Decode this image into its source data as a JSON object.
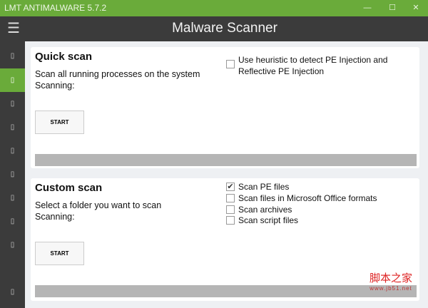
{
  "window": {
    "title": "LMT ANTIMALWARE 5.7.2",
    "minimize": "—",
    "maximize": "☐",
    "close": "✕"
  },
  "header": {
    "menu_icon": "☰",
    "title": "Malware Scanner"
  },
  "sidebar": {
    "items": [
      "▯",
      "▯",
      "▯",
      "▯",
      "▯",
      "▯",
      "▯",
      "▯",
      "▯",
      "▯"
    ],
    "active_index": 1
  },
  "quick_scan": {
    "title": "Quick scan",
    "description": "Scan all running processes on the system",
    "status": "Scanning:",
    "start": "START",
    "progress": 0,
    "options": [
      {
        "label": "Use heuristic to detect PE Injection and",
        "label2": "Reflective PE Injection",
        "checked": false
      }
    ]
  },
  "custom_scan": {
    "title": "Custom scan",
    "description": "Select a folder you want to scan",
    "status": "Scanning:",
    "start": "START",
    "progress": 0,
    "options": [
      {
        "label": "Scan PE files",
        "checked": true
      },
      {
        "label": "Scan files in Microsoft Office formats",
        "checked": false
      },
      {
        "label": "Scan archives",
        "checked": false
      },
      {
        "label": "Scan script files",
        "checked": false
      }
    ]
  },
  "watermark": {
    "text": "脚本之家",
    "url": "www.jb51.net"
  },
  "colors": {
    "accent": "#6aab3a",
    "dark": "#3b3b3b"
  }
}
